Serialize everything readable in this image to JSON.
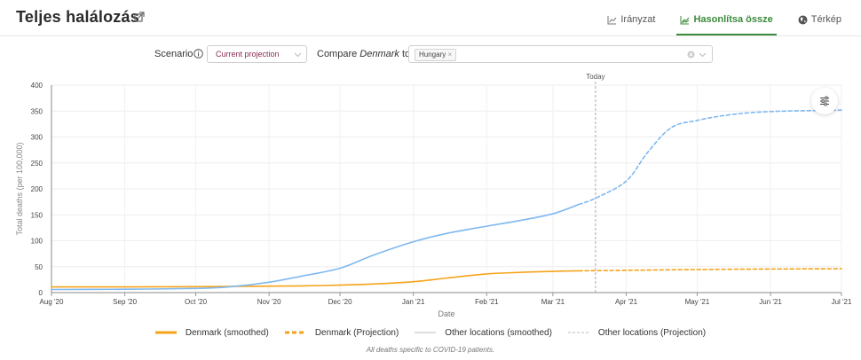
{
  "header": {
    "title": "Teljes halálozás",
    "tabs": [
      {
        "label": "Irányzat",
        "icon": "trend-chart-icon",
        "active": false
      },
      {
        "label": "Hasonlítsa össze",
        "icon": "compare-chart-icon",
        "active": true
      },
      {
        "label": "Térkép",
        "icon": "globe-icon",
        "active": false
      }
    ]
  },
  "controls": {
    "scenario_label": "Scenario",
    "scenario_value": "Current projection",
    "compare_prefix": "Compare ",
    "compare_location": "Denmark",
    "compare_suffix": " to",
    "compare_chip": "Hungary",
    "chip_remove": "×"
  },
  "colors": {
    "denmark": "#f5a31a",
    "other": "#7fb8f0",
    "accent": "#3c8a3c",
    "today_line": "#aaaaaa"
  },
  "chart_data": {
    "type": "line",
    "xlabel": "Date",
    "ylabel": "Total deaths (per 100,000)",
    "ylim": [
      0,
      400
    ],
    "yticks": [
      0,
      50,
      100,
      150,
      200,
      250,
      300,
      350,
      400
    ],
    "xlim": [
      "2020-08-01",
      "2021-07-01"
    ],
    "xticks": [
      {
        "date": "2020-08-01",
        "label": "Aug '20"
      },
      {
        "date": "2020-09-01",
        "label": "Sep '20"
      },
      {
        "date": "2020-10-01",
        "label": "Oct '20"
      },
      {
        "date": "2020-11-01",
        "label": "Nov '20"
      },
      {
        "date": "2020-12-01",
        "label": "Dec '20"
      },
      {
        "date": "2021-01-01",
        "label": "Jan '21"
      },
      {
        "date": "2021-02-01",
        "label": "Feb '21"
      },
      {
        "date": "2021-03-01",
        "label": "Mar '21"
      },
      {
        "date": "2021-04-01",
        "label": "Apr '21"
      },
      {
        "date": "2021-05-01",
        "label": "May '21"
      },
      {
        "date": "2021-06-01",
        "label": "Jun '21"
      },
      {
        "date": "2021-07-01",
        "label": "Jul '21"
      }
    ],
    "today": {
      "date": "2021-03-19",
      "label": "Today"
    },
    "grid": true,
    "legend_position": "bottom",
    "series": [
      {
        "name": "Denmark (smoothed)",
        "color": "#f5a31a",
        "style": "solid",
        "points": [
          [
            "2020-08-01",
            11
          ],
          [
            "2020-09-01",
            11
          ],
          [
            "2020-10-01",
            11.5
          ],
          [
            "2020-11-01",
            12.5
          ],
          [
            "2020-11-15",
            13
          ],
          [
            "2020-12-01",
            14.5
          ],
          [
            "2020-12-15",
            16.5
          ],
          [
            "2021-01-01",
            21
          ],
          [
            "2021-01-15",
            28
          ],
          [
            "2021-02-01",
            36
          ],
          [
            "2021-02-15",
            39
          ],
          [
            "2021-03-01",
            41
          ],
          [
            "2021-03-12",
            42
          ]
        ]
      },
      {
        "name": "Denmark (Projection)",
        "color": "#f5a31a",
        "style": "dashed",
        "points": [
          [
            "2021-03-12",
            42
          ],
          [
            "2021-04-01",
            43
          ],
          [
            "2021-05-01",
            44.5
          ],
          [
            "2021-06-01",
            45.5
          ],
          [
            "2021-07-01",
            46
          ]
        ]
      },
      {
        "name": "Other locations (smoothed)",
        "color": "#7fb8f0",
        "style": "solid",
        "points": [
          [
            "2020-08-01",
            6
          ],
          [
            "2020-09-01",
            6.5
          ],
          [
            "2020-10-01",
            8
          ],
          [
            "2020-10-15",
            11
          ],
          [
            "2020-11-01",
            20
          ],
          [
            "2020-11-15",
            32
          ],
          [
            "2020-12-01",
            47
          ],
          [
            "2020-12-15",
            72
          ],
          [
            "2021-01-01",
            98
          ],
          [
            "2021-01-15",
            114
          ],
          [
            "2021-02-01",
            128
          ],
          [
            "2021-02-15",
            139
          ],
          [
            "2021-03-01",
            152
          ],
          [
            "2021-03-12",
            170
          ]
        ]
      },
      {
        "name": "Other locations (Projection)",
        "color": "#7fb8f0",
        "style": "dashed",
        "points": [
          [
            "2021-03-12",
            170
          ],
          [
            "2021-03-19",
            182
          ],
          [
            "2021-04-01",
            215
          ],
          [
            "2021-04-10",
            270
          ],
          [
            "2021-04-20",
            318
          ],
          [
            "2021-05-01",
            332
          ],
          [
            "2021-05-15",
            343
          ],
          [
            "2021-06-01",
            349
          ],
          [
            "2021-07-01",
            352
          ]
        ]
      }
    ],
    "legend": [
      {
        "label": "Denmark (smoothed)",
        "color": "#f5a31a",
        "style": "solid"
      },
      {
        "label": "Denmark (Projection)",
        "color": "#f5a31a",
        "style": "dashed"
      },
      {
        "label": "Other locations (smoothed)",
        "color": "#bbbbbb",
        "style": "thin-solid"
      },
      {
        "label": "Other locations (Projection)",
        "color": "#bbbbbb",
        "style": "thin-dashed"
      }
    ]
  },
  "footnote": "All deaths specific to COVID-19 patients."
}
